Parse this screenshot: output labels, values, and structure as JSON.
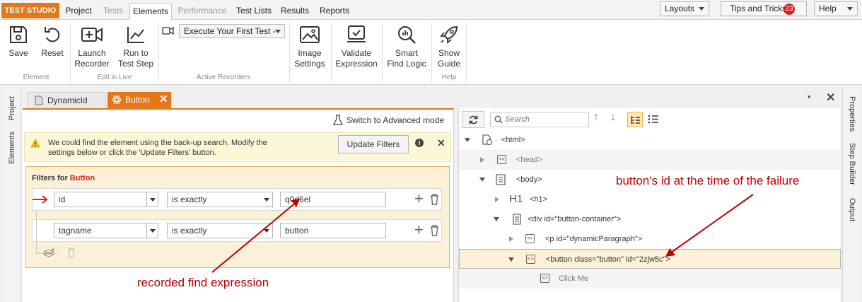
{
  "menubar": {
    "brand": "TEST STUDIO",
    "tabs": [
      {
        "label": "Project",
        "state": "normal"
      },
      {
        "label": "Tests",
        "state": "disabled"
      },
      {
        "label": "Elements",
        "state": "active"
      },
      {
        "label": "Performance",
        "state": "disabled"
      },
      {
        "label": "Test Lists",
        "state": "normal"
      },
      {
        "label": "Results",
        "state": "normal"
      },
      {
        "label": "Reports",
        "state": "normal"
      }
    ],
    "layouts_label": "Layouts",
    "tips_label": "Tips and Tricks",
    "tips_count": "23",
    "help_label": "Help"
  },
  "ribbon": {
    "save": "Save",
    "reset": "Reset",
    "group_element": "Element",
    "launch_recorder": [
      "Launch",
      "Recorder"
    ],
    "run_to_test_step": [
      "Run to",
      "Test Step"
    ],
    "group_edit_in_live": "Edit in Live",
    "recorder_select": "Execute Your First Test -",
    "group_active_recorders": "Active Recorders",
    "image_settings": [
      "Image",
      "Settings"
    ],
    "validate_expression": [
      "Validate",
      "Expression"
    ],
    "smart_find_logic": [
      "Smart",
      "Find Logic"
    ],
    "show_guide": [
      "Show",
      "Guide"
    ],
    "group_help": "Help"
  },
  "left_rail": {
    "project": "Project",
    "elements": "Elements"
  },
  "right_rail": {
    "properties": "Properties",
    "step_builder": "Step Builder",
    "output": "Output"
  },
  "doc_tabs": [
    {
      "label": "DynamicId",
      "active": false
    },
    {
      "label": "Button",
      "active": true
    }
  ],
  "element_panel": {
    "advanced_mode": "Switch to Advanced mode",
    "warning_text_1": "We could find the element using the back-up search. Modify the",
    "warning_text_2": "settings below or click the 'Update Filters' button.",
    "update_filters": "Update Filters",
    "filters_for_prefix": "Filters for",
    "filters_for_element": "Button",
    "filters": [
      {
        "attribute": "id",
        "operator": "is exactly",
        "value": "q0d6el"
      },
      {
        "attribute": "tagname",
        "operator": "is exactly",
        "value": "button"
      }
    ]
  },
  "dom_panel": {
    "search_placeholder": "Search",
    "nodes": [
      {
        "text": "<html>",
        "indent": 0,
        "expander": "expanded"
      },
      {
        "text": "<head>",
        "indent": 1,
        "expander": "collapsed"
      },
      {
        "text": "<body>",
        "indent": 1,
        "expander": "expanded"
      },
      {
        "text": "<h1>",
        "indent": 2,
        "expander": "collapsed",
        "icon": "H1"
      },
      {
        "text": "<div id=\"button-container\">",
        "indent": 2,
        "expander": "expanded"
      },
      {
        "text": "<p id=\"dynamicParagraph\">",
        "indent": 3,
        "expander": "collapsed"
      },
      {
        "text": "<button class=\"button\" id=\"2zjw5c\">",
        "indent": 3,
        "expander": "expanded",
        "selected": true
      },
      {
        "text": "Click Me",
        "indent": 4,
        "expander": "none"
      }
    ]
  },
  "annotations": {
    "recorded": "recorded find expression",
    "failure": "button's id at the time of the failure"
  },
  "colors": {
    "accent": "#e57719",
    "annotation": "#c00000",
    "badge": "#d9211c"
  }
}
